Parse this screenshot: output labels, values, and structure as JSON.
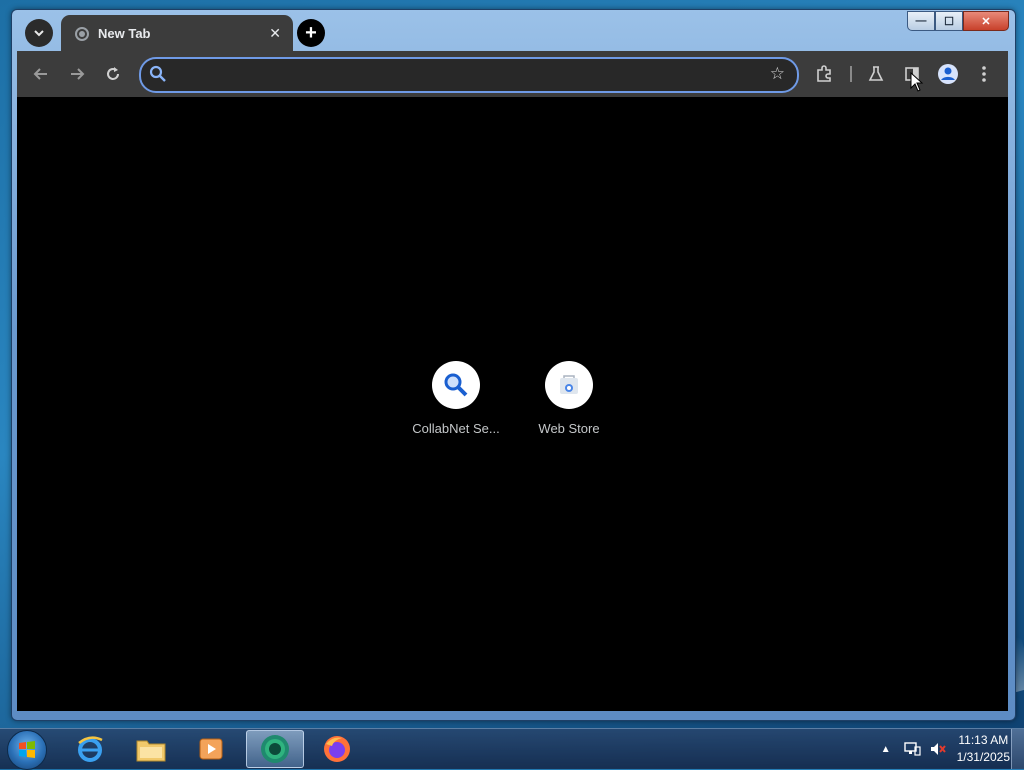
{
  "window": {
    "caption": {
      "minimize": "—",
      "maximize": "☐",
      "close": "✕"
    }
  },
  "browser": {
    "tab": {
      "title": "New Tab",
      "close": "✕"
    },
    "new_tab": "+",
    "tab_search": "⌄",
    "omnibox": {
      "value": "",
      "placeholder": ""
    },
    "toolbar_icons": [
      "back-icon",
      "forward-icon",
      "reload-icon",
      "bookmark-star-icon",
      "extensions-icon",
      "labs-flask-icon",
      "side-panel-icon",
      "profile-icon",
      "menu-icon"
    ]
  },
  "shortcuts": [
    {
      "label": "CollabNet Se...",
      "icon": "search-magnifier-icon"
    },
    {
      "label": "Web Store",
      "icon": "web-store-icon"
    }
  ],
  "taskbar": {
    "apps": [
      "internet-explorer-icon",
      "file-explorer-icon",
      "media-player-icon",
      "chrome-icon",
      "firefox-icon"
    ],
    "clock": {
      "time": "11:13 AM",
      "date": "1/31/2025"
    }
  },
  "colors": {
    "accent": "#6f9ae6",
    "page_bg": "#000000",
    "toolbar_bg": "#3c3c3c"
  }
}
